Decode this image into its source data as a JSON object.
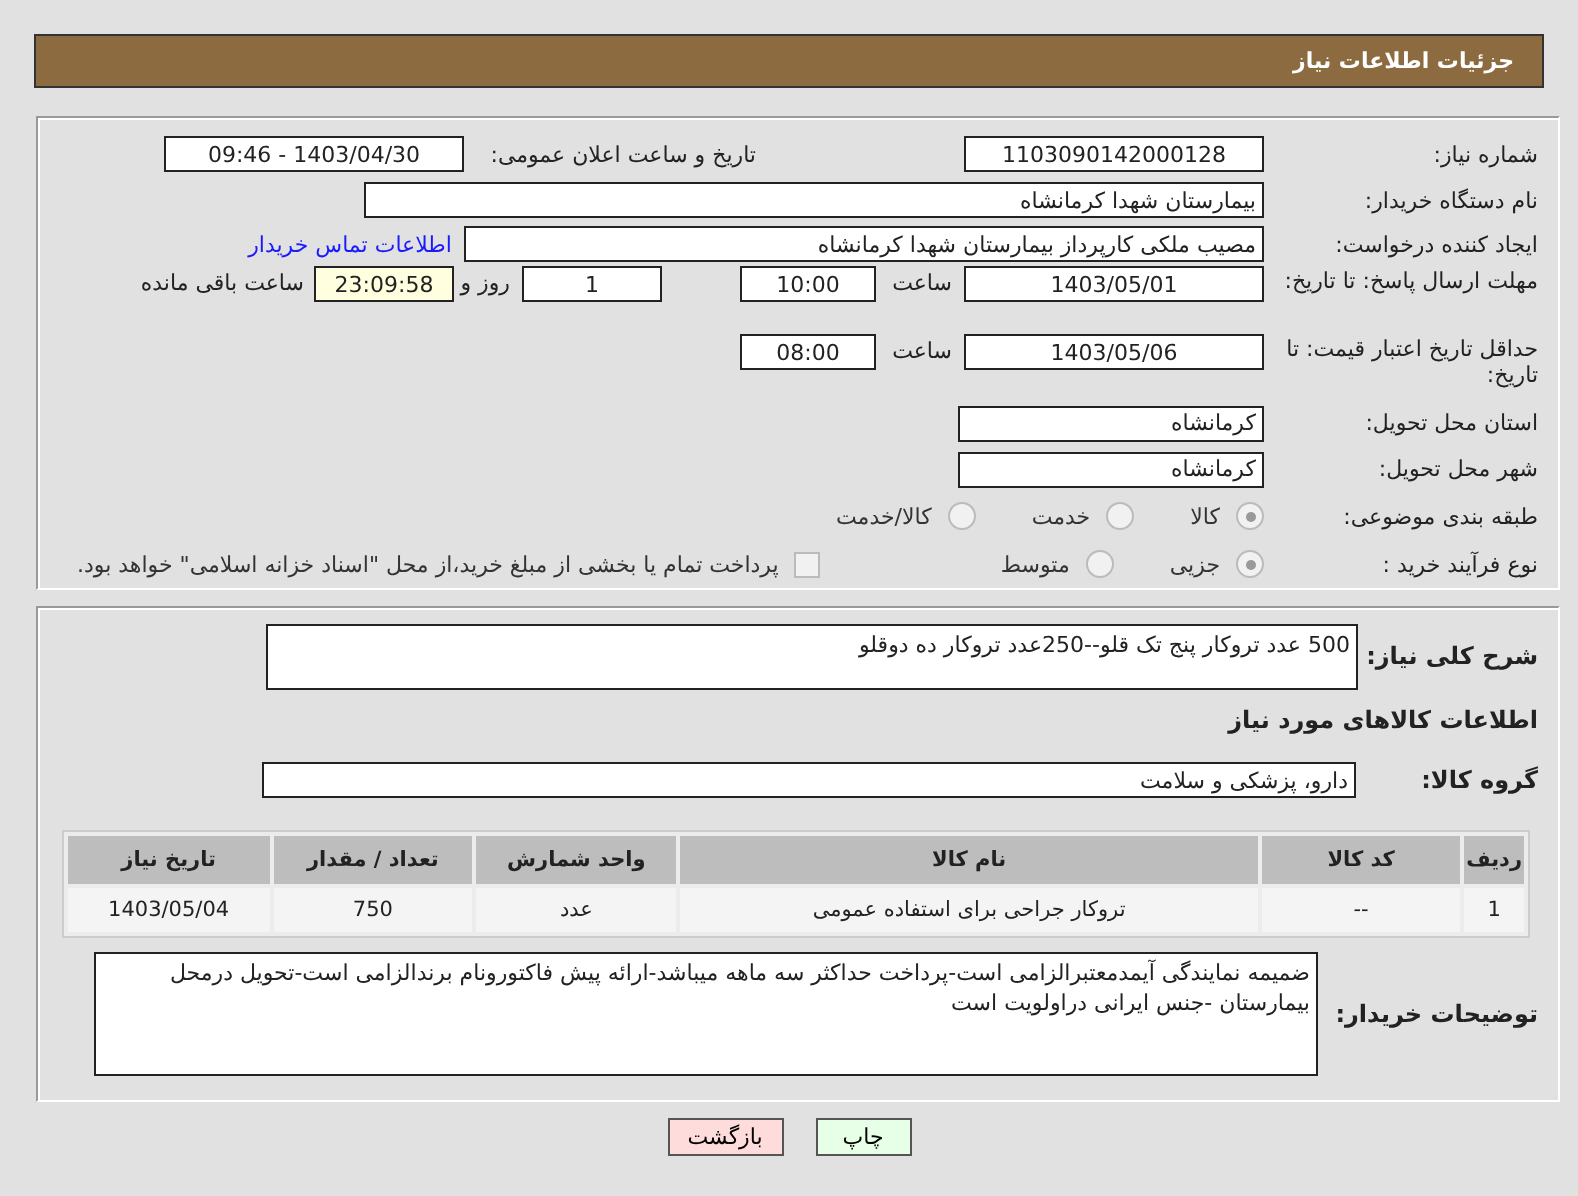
{
  "header": {
    "title": "جزئیات اطلاعات نیاز"
  },
  "need_number": {
    "label": "شماره نیاز:",
    "value": "1103090142000128"
  },
  "announce": {
    "label": "تاریخ و ساعت اعلان عمومی:",
    "value": "1403/04/30 - 09:46"
  },
  "buyer": {
    "label": "نام دستگاه خریدار:",
    "value": "بیمارستان شهدا کرمانشاه"
  },
  "requester": {
    "label": "ایجاد کننده درخواست:",
    "value": "مصیب ملکی کارپرداز بیمارستان شهدا کرمانشاه",
    "link": "اطلاعات تماس خریدار"
  },
  "deadline": {
    "label": "مهلت ارسال پاسخ: تا تاریخ:",
    "date": "1403/05/01",
    "time_label": "ساعت",
    "time": "10:00",
    "days": "1",
    "days_label": "روز و",
    "remaining": "23:09:58",
    "remaining_label": "ساعت باقی مانده"
  },
  "validity": {
    "label": "حداقل تاریخ اعتبار قیمت: تا تاریخ:",
    "date": "1403/05/06",
    "time_label": "ساعت",
    "time": "08:00"
  },
  "province": {
    "label": "استان محل تحویل:",
    "value": "کرمانشاه"
  },
  "city": {
    "label": "شهر محل تحویل:",
    "value": "کرمانشاه"
  },
  "category": {
    "label": "طبقه بندی موضوعی:",
    "options": [
      {
        "label": "کالا",
        "selected": true
      },
      {
        "label": "خدمت",
        "selected": false
      },
      {
        "label": "کالا/خدمت",
        "selected": false
      }
    ]
  },
  "process": {
    "label": "نوع فرآیند خرید :",
    "options": [
      {
        "label": "جزیی",
        "selected": true
      },
      {
        "label": "متوسط",
        "selected": false
      }
    ],
    "payment": {
      "label": "پرداخت تمام یا بخشی از مبلغ خرید،از محل \"اسناد خزانه اسلامی\" خواهد بود.",
      "checked": false
    }
  },
  "description": {
    "label": "شرح کلی نیاز:",
    "value": "500 عدد تروکار پنج تک قلو--250عدد تروکار ده دوقلو"
  },
  "items_section": {
    "title": "اطلاعات کالاهای مورد نیاز"
  },
  "goods_group": {
    "label": "گروه کالا:",
    "value": "دارو، پزشکی و سلامت"
  },
  "table": {
    "columns": [
      "ردیف",
      "کد کالا",
      "نام کالا",
      "واحد شمارش",
      "تعداد / مقدار",
      "تاریخ نیاز"
    ],
    "rows": [
      [
        "1",
        "--",
        "تروکار جراحی برای استفاده عمومی",
        "عدد",
        "750",
        "1403/05/04"
      ]
    ]
  },
  "buyer_notes": {
    "label": "توضیحات خریدار:",
    "value": "ضمیمه نمایندگی آیمدمعتبرالزامی است-پرداخت حداکثر سه ماهه میباشد-ارائه پیش فاکتورونام برندالزامی است-تحویل درمحل بیمارستان -جنس ایرانی دراولویت است"
  },
  "buttons": [
    {
      "label": "چاپ",
      "kind": "print"
    },
    {
      "label": "بازگشت",
      "kind": "back"
    }
  ]
}
